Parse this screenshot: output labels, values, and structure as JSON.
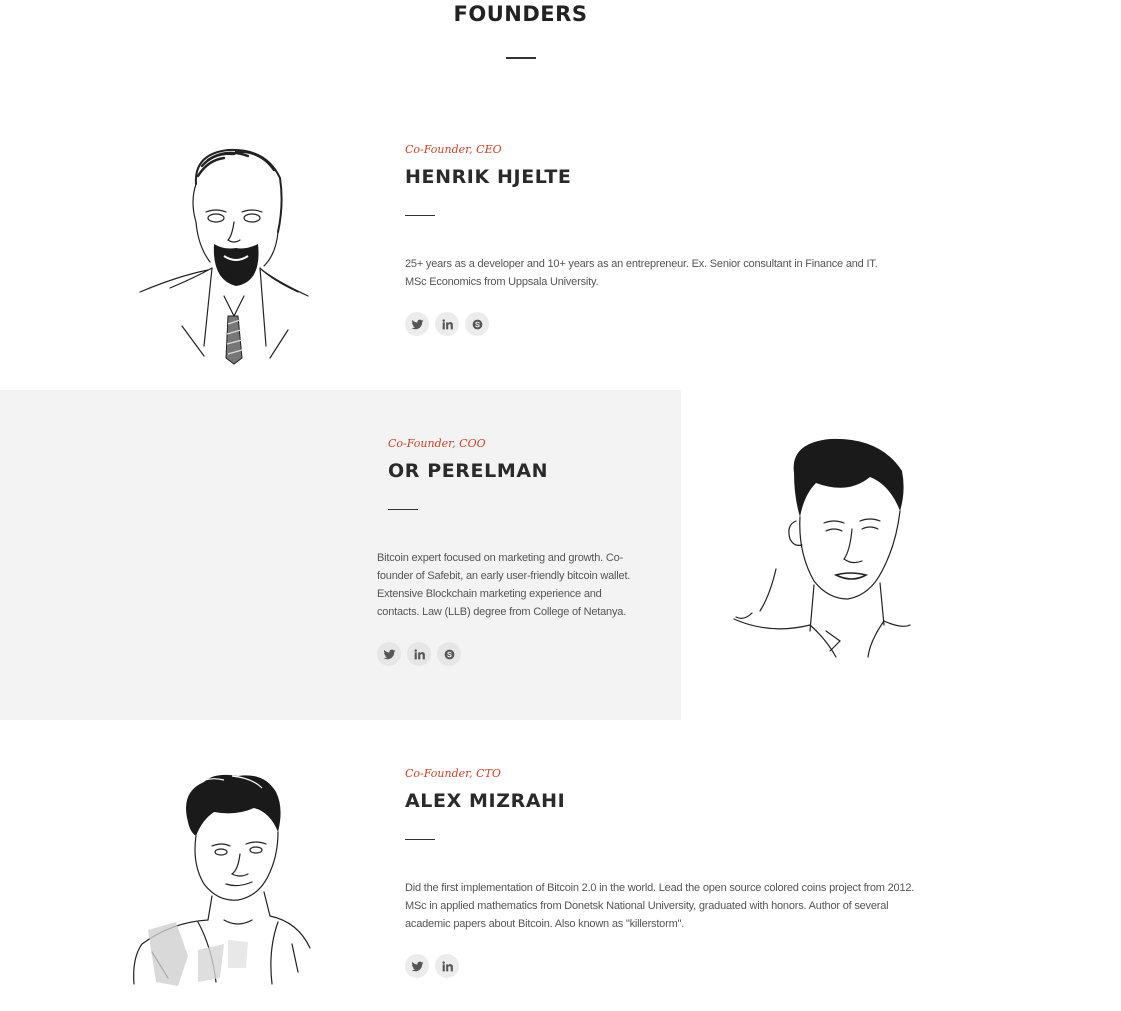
{
  "section": {
    "title": "FOUNDERS"
  },
  "founders": [
    {
      "role": "Co-Founder, CEO",
      "name": "HENRIK HJELTE",
      "bio": "25+ years as a developer and 10+ years as an entrepreneur. Ex. Senior consultant in Finance and IT. MSc Economics from Uppsala University.",
      "socials": [
        "twitter-icon",
        "linkedin-icon",
        "skype-icon"
      ]
    },
    {
      "role": "Co-Founder, COO",
      "name": "OR PERELMAN",
      "bio": "Bitcoin expert focused on marketing and growth. Co-founder of Safebit, an early user-friendly bitcoin wallet. Extensive Blockchain marketing experience and contacts. Law (LLB) degree from College of Netanya.",
      "socials": [
        "twitter-icon",
        "linkedin-icon",
        "skype-icon"
      ]
    },
    {
      "role": "Co-Founder, CTO",
      "name": "ALEX MIZRAHI",
      "bio": "Did the first implementation of Bitcoin 2.0 in the world. Lead the open source colored coins project from 2012. MSc in applied mathematics from Donetsk National University, graduated with honors. Author of several academic papers about Bitcoin. Also known as \"killerstorm\".",
      "socials": [
        "twitter-icon",
        "linkedin-icon"
      ]
    }
  ],
  "colors": {
    "accent": "#c8442a",
    "heading": "#2a2a2a",
    "highlight_bg": "#f3f3f3",
    "social_bg": "#ececec",
    "icon": "#555555"
  }
}
